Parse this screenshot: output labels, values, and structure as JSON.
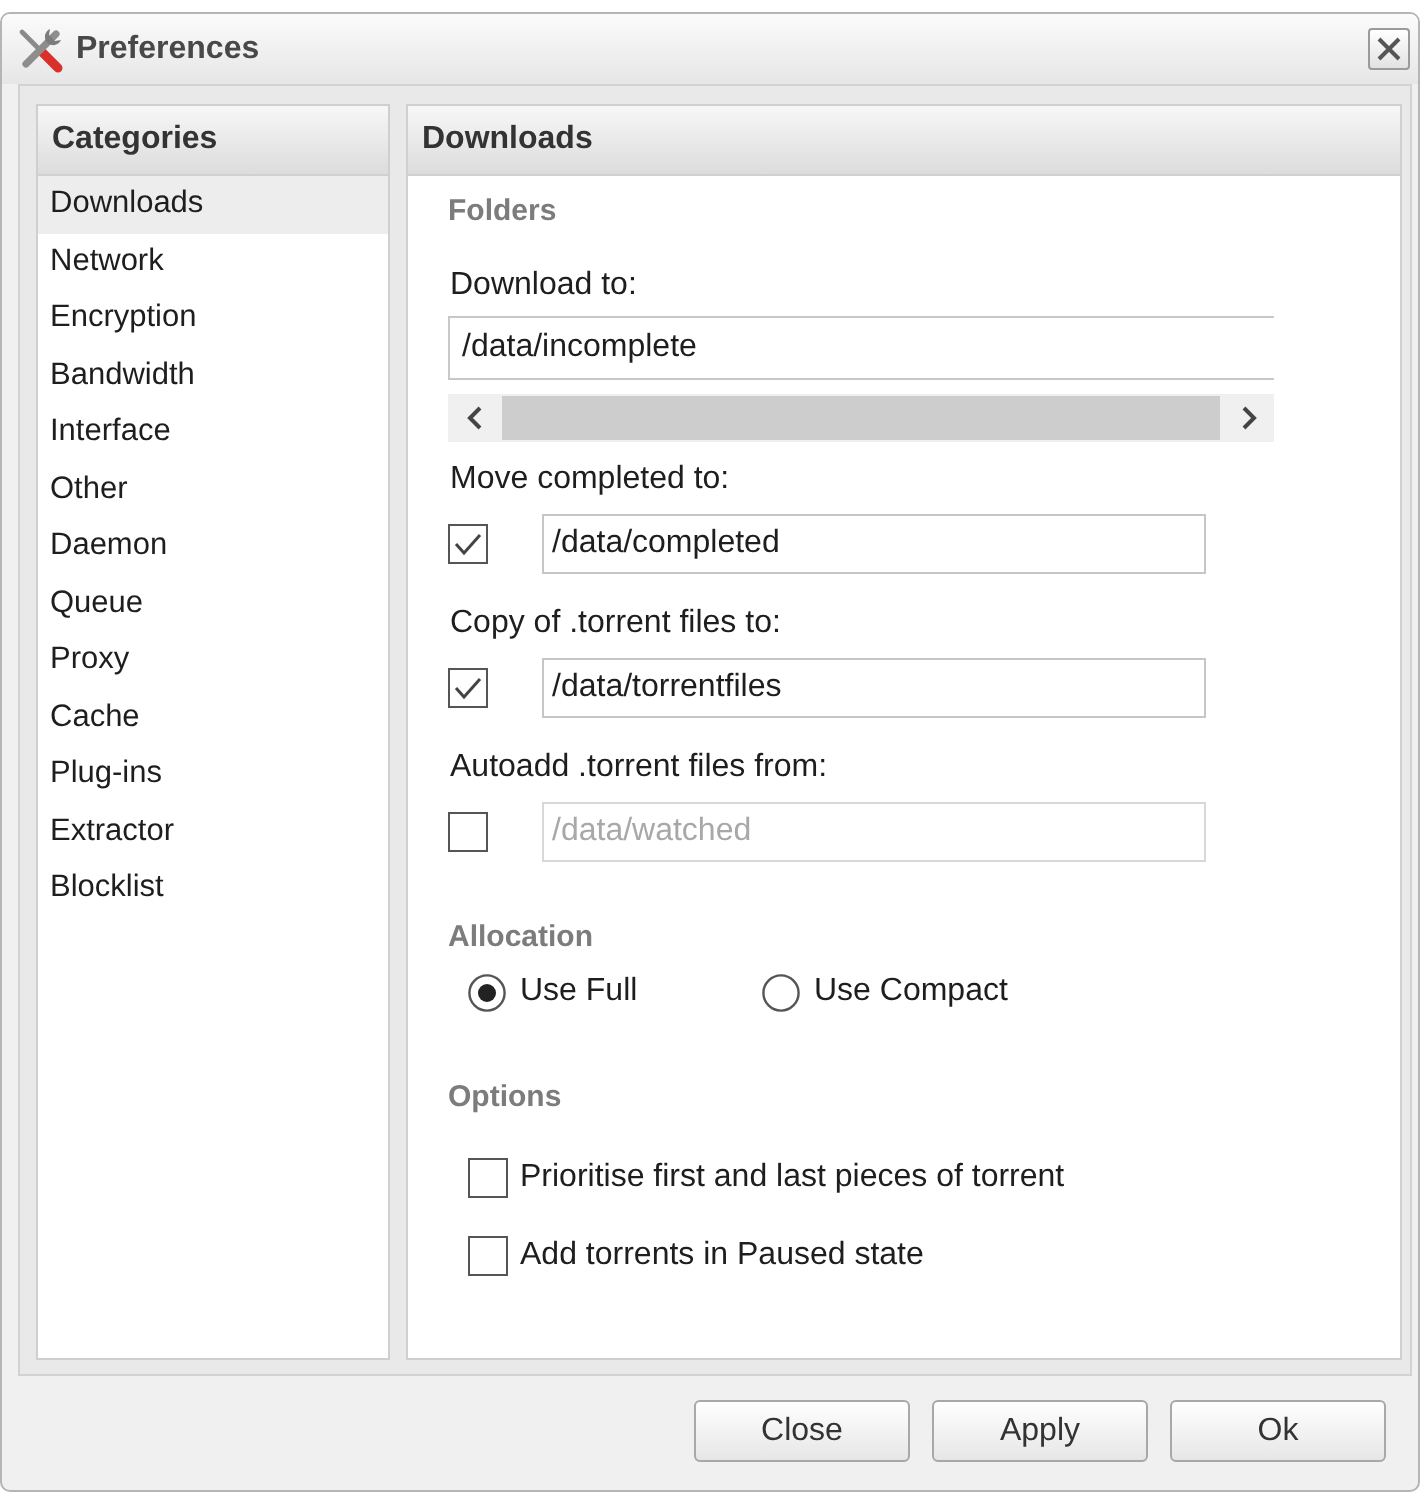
{
  "window": {
    "title": "Preferences"
  },
  "categories": {
    "title": "Categories",
    "items": [
      {
        "label": "Downloads",
        "selected": true
      },
      {
        "label": "Network",
        "selected": false
      },
      {
        "label": "Encryption",
        "selected": false
      },
      {
        "label": "Bandwidth",
        "selected": false
      },
      {
        "label": "Interface",
        "selected": false
      },
      {
        "label": "Other",
        "selected": false
      },
      {
        "label": "Daemon",
        "selected": false
      },
      {
        "label": "Queue",
        "selected": false
      },
      {
        "label": "Proxy",
        "selected": false
      },
      {
        "label": "Cache",
        "selected": false
      },
      {
        "label": "Plug-ins",
        "selected": false
      },
      {
        "label": "Extractor",
        "selected": false
      },
      {
        "label": "Blocklist",
        "selected": false
      }
    ]
  },
  "page": {
    "title": "Downloads"
  },
  "folders": {
    "title": "Folders",
    "download_to": {
      "label": "Download to:",
      "value": "/data/incomplete"
    },
    "paths": [
      {
        "label": "Move completed to:",
        "checked": true,
        "value": "/data/completed"
      },
      {
        "label": "Copy of .torrent files to:",
        "checked": true,
        "value": "/data/torrentfiles"
      },
      {
        "label": "Autoadd .torrent files from:",
        "checked": false,
        "value": "/data/watched"
      }
    ]
  },
  "allocation": {
    "title": "Allocation",
    "options": [
      {
        "label": "Use Full",
        "selected": true
      },
      {
        "label": "Use Compact",
        "selected": false
      }
    ]
  },
  "options": {
    "title": "Options",
    "items": [
      {
        "label": "Prioritise first and last pieces of torrent",
        "checked": false
      },
      {
        "label": "Add torrents in Paused state",
        "checked": false
      }
    ]
  },
  "buttons": [
    "Close",
    "Apply",
    "Ok"
  ]
}
